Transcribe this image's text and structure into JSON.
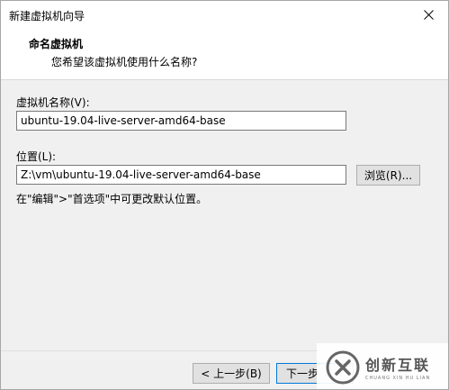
{
  "window": {
    "title": "新建虚拟机向导"
  },
  "header": {
    "title": "命名虚拟机",
    "subtitle": "您希望该虚拟机使用什么名称?"
  },
  "form": {
    "name_label": "虚拟机名称(V):",
    "name_value": "ubuntu-19.04-live-server-amd64-base",
    "location_label": "位置(L):",
    "location_value": "Z:\\vm\\ubuntu-19.04-live-server-amd64-base",
    "browse_label": "浏览(R)...",
    "hint": "在\"编辑\">\"首选项\"中可更改默认位置。"
  },
  "footer": {
    "back_label": "< 上一步(B)",
    "next_label": "下一步"
  },
  "watermark": {
    "brand_cn": "创新互联",
    "brand_en": "CHUANG XIN HU LIAN"
  },
  "icons": {
    "close": "close-icon",
    "watermark": "brand-logo-icon"
  }
}
